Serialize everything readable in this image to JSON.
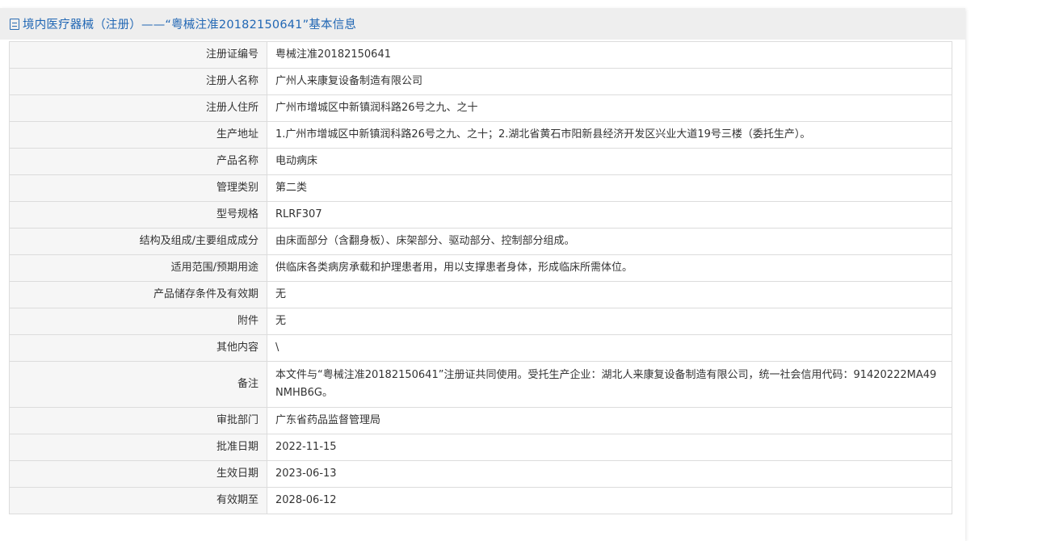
{
  "header": {
    "icon": "document-icon",
    "title": "境内医疗器械（注册）——“粤械注准20182150641”基本信息"
  },
  "rows": [
    {
      "label": "注册证编号",
      "value": "粤械注准20182150641"
    },
    {
      "label": "注册人名称",
      "value": "广州人来康复设备制造有限公司"
    },
    {
      "label": "注册人住所",
      "value": "广州市增城区中新镇润科路26号之九、之十"
    },
    {
      "label": "生产地址",
      "value": "1.广州市增城区中新镇润科路26号之九、之十；2.湖北省黄石市阳新县经济开发区兴业大道19号三楼（委托生产）。"
    },
    {
      "label": "产品名称",
      "value": "电动病床"
    },
    {
      "label": "管理类别",
      "value": "第二类"
    },
    {
      "label": "型号规格",
      "value": "RLRF307"
    },
    {
      "label": "结构及组成/主要组成成分",
      "value": "由床面部分（含翻身板）、床架部分、驱动部分、控制部分组成。"
    },
    {
      "label": "适用范围/预期用途",
      "value": "供临床各类病房承载和护理患者用，用以支撑患者身体，形成临床所需体位。"
    },
    {
      "label": "产品储存条件及有效期",
      "value": "无"
    },
    {
      "label": "附件",
      "value": "无"
    },
    {
      "label": "其他内容",
      "value": "\\"
    },
    {
      "label": "备注",
      "value": "本文件与“粤械注准20182150641”注册证共同使用。受托生产企业：湖北人来康复设备制造有限公司，统一社会信用代码：91420222MA49NMHB6G。"
    },
    {
      "label": "审批部门",
      "value": "广东省药品监督管理局"
    },
    {
      "label": "批准日期",
      "value": "2022-11-15"
    },
    {
      "label": "生效日期",
      "value": "2023-06-13"
    },
    {
      "label": "有效期至",
      "value": "2028-06-12"
    }
  ]
}
